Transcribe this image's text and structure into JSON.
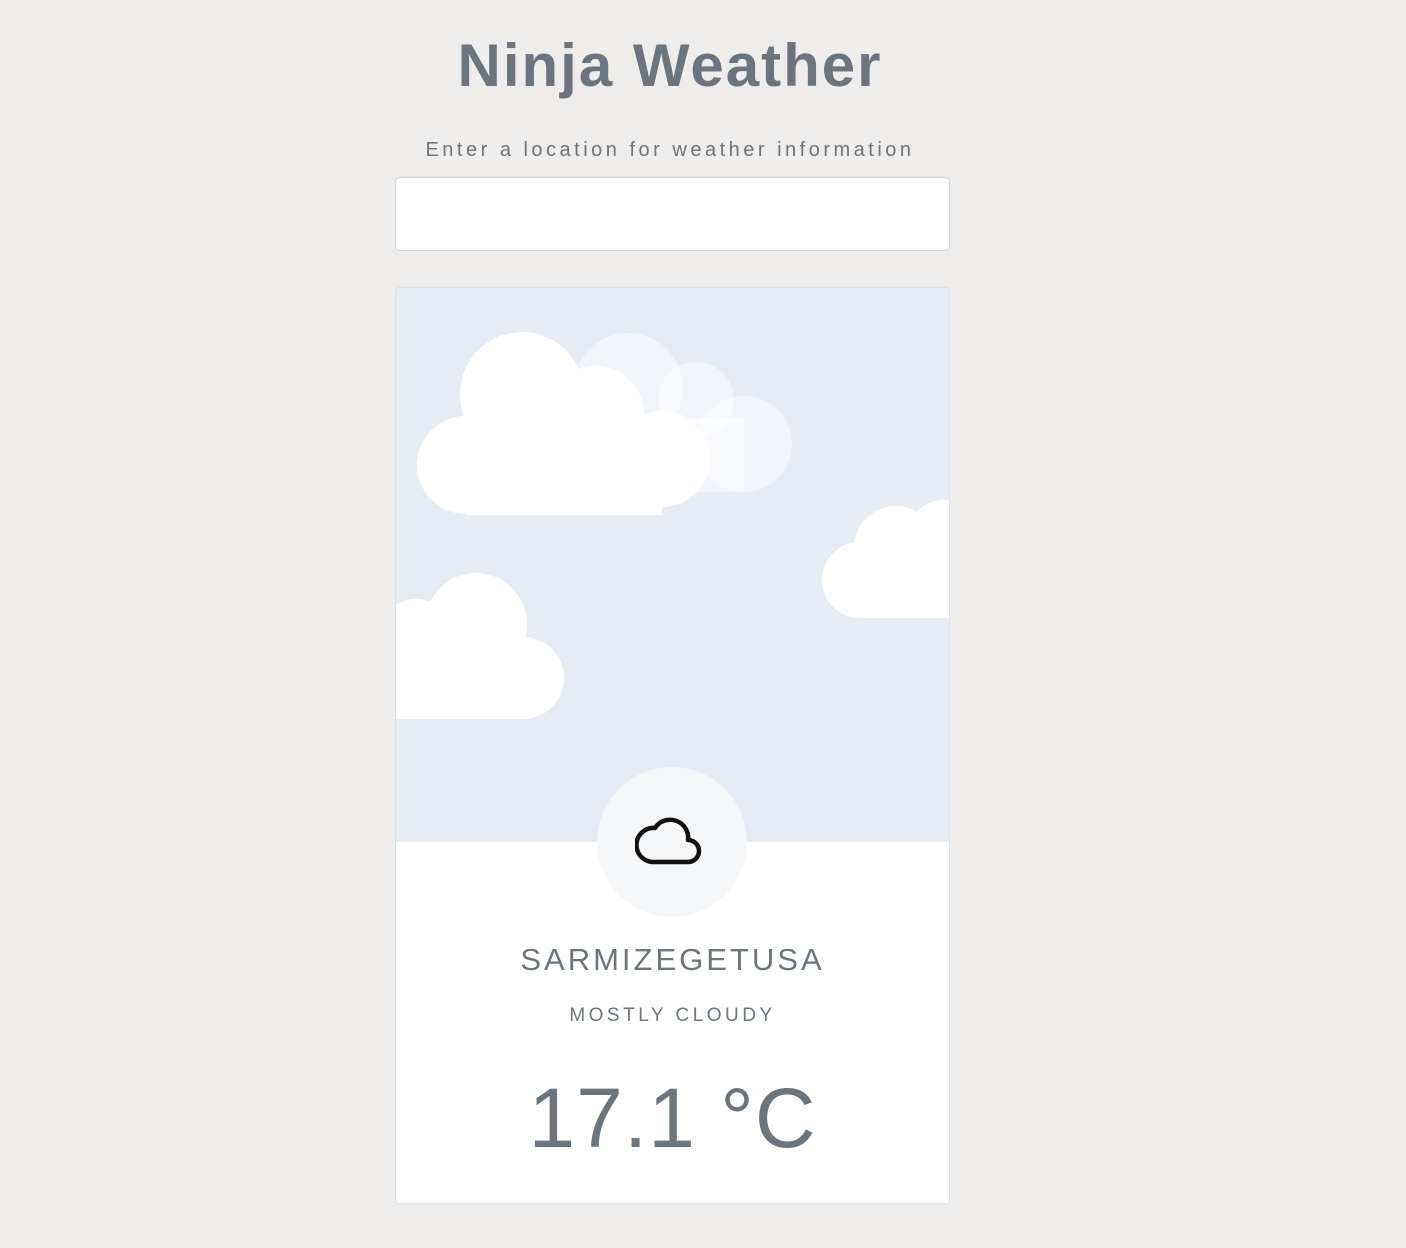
{
  "header": {
    "title": "Ninja Weather",
    "prompt": "Enter a location for weather information"
  },
  "search": {
    "value": "",
    "placeholder": ""
  },
  "weather": {
    "city": "SARMIZEGETUSA",
    "condition": "MOSTLY CLOUDY",
    "temperature": "17.1 °C",
    "icon": "cloud-icon",
    "scene": "clouds-illustration"
  },
  "colors": {
    "background": "#eeedeb",
    "text": "#6c757d",
    "sky": "#e6ebf4",
    "card": "#ffffff"
  }
}
